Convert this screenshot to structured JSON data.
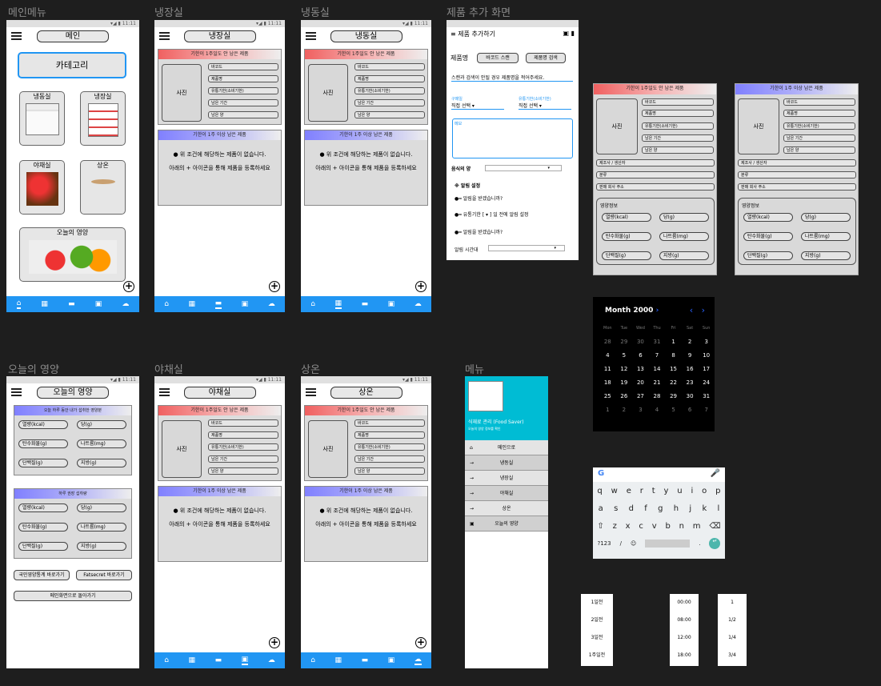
{
  "labels": {
    "main": "메인메뉴",
    "fridge": "냉장실",
    "freezer": "냉동실",
    "add": "제품 추가 화면",
    "nutrition": "오늘의 영양",
    "veg": "야채실",
    "room": "상온",
    "menu": "메뉴"
  },
  "status": "▾◢ ▮ 11:11",
  "main": {
    "title": "메인",
    "category": "카테고리",
    "freezer": "냉동실",
    "fridge": "냉장실",
    "veg": "야채실",
    "room": "상온",
    "nutrition": "오늘의 영양"
  },
  "fridge_screen": {
    "title": "냉장실"
  },
  "freezer_screen": {
    "title": "냉동실"
  },
  "veg_screen": {
    "title": "야채실"
  },
  "room_screen": {
    "title": "상온"
  },
  "expire_soon": "기한이 1주일도 안 남은 제품",
  "expire_long": "기한이 1주 이상 남은 제품",
  "photo": "사진",
  "fields": [
    "바코드",
    "제품명",
    "유통기한(소비기한)",
    "남은 기간",
    "남은 양"
  ],
  "empty1": "위 조건에 해당하는 제품이 없습니다.",
  "empty2_a": "아래의",
  "empty2_b": "아이콘을 통해 제품을 등록하세요",
  "add": {
    "title": "제품 추가하기",
    "name_label": "제품명",
    "barcode_btn": "바코드 스캔",
    "search_btn": "제품명 검색",
    "hint": "스캔과 검색이 안될 경우 제품명을 적어주세요.",
    "buy_label": "구매일",
    "buy_value": "직접 선택",
    "exp_label": "유통기한(소비기한)",
    "exp_value": "직접 선택",
    "memo": "메모",
    "amount": "음식의 양",
    "alarm_title": "※ 알림 설정",
    "alarm1": "알림을 받겠습니까?",
    "alarm2a": "유통기한",
    "alarm2b": "일 전에 알림 설정",
    "alarm3": "알림을 받겠습니까?",
    "alarm_time": "알림 시간대"
  },
  "detail_extra": [
    "제조사 / 생산자",
    "분류",
    "판매 회사 주소"
  ],
  "nutrition_info": "영양정보",
  "nutrients": [
    "열량(kcal)",
    "당(g)",
    "탄수화물(g)",
    "나트륨(mg)",
    "단백질(g)",
    "지방(g)"
  ],
  "nutrition_screen": {
    "title": "오늘의 영양",
    "sec1": "오늘 하루 동안 내가 섭취한 영양분",
    "sec2": "하루 권장 섭취량",
    "btn1": "국민영양통계 바로가기",
    "btn2": "Fatsecret 바로가기",
    "btn3": "메인화면으로 돌아가기"
  },
  "menu_screen": {
    "app_name": "식재료 관리 (Food Saver)",
    "sub": "오늘의 영양 정보를 확인",
    "items": [
      "메인으로",
      "냉동실",
      "냉장실",
      "야채실",
      "상온",
      "오늘의 영양"
    ]
  },
  "calendar": {
    "title": "Month 2000",
    "days": [
      "Mon",
      "Tue",
      "Wed",
      "Thu",
      "Fri",
      "Sat",
      "Sun"
    ],
    "rows": [
      [
        "28",
        "29",
        "30",
        "31",
        "1",
        "2",
        "3"
      ],
      [
        "4",
        "5",
        "6",
        "7",
        "8",
        "9",
        "10"
      ],
      [
        "11",
        "12",
        "13",
        "14",
        "15",
        "16",
        "17"
      ],
      [
        "18",
        "19",
        "20",
        "21",
        "22",
        "23",
        "24"
      ],
      [
        "25",
        "26",
        "27",
        "28",
        "29",
        "30",
        "31"
      ],
      [
        "1",
        "2",
        "3",
        "4",
        "5",
        "6",
        "7"
      ]
    ]
  },
  "keyboard": {
    "row1": [
      "q",
      "w",
      "e",
      "r",
      "t",
      "y",
      "u",
      "i",
      "o",
      "p"
    ],
    "row2": [
      "a",
      "s",
      "d",
      "f",
      "g",
      "h",
      "j",
      "k",
      "l"
    ],
    "row3": [
      "z",
      "x",
      "c",
      "v",
      "b",
      "n",
      "m"
    ],
    "num": "?123"
  },
  "pickers": {
    "days": [
      "1일전",
      "2일전",
      "3일전",
      "1주일전"
    ],
    "times": [
      "00:00",
      "08:00",
      "12:00",
      "18:00"
    ],
    "fractions": [
      "1",
      "1/2",
      "1/4",
      "3/4"
    ]
  },
  "colors": {
    "accent": "#2196f3",
    "red_head": "#f06060",
    "blue_head": "#8080ff",
    "menu_head": "#00bcd4"
  }
}
